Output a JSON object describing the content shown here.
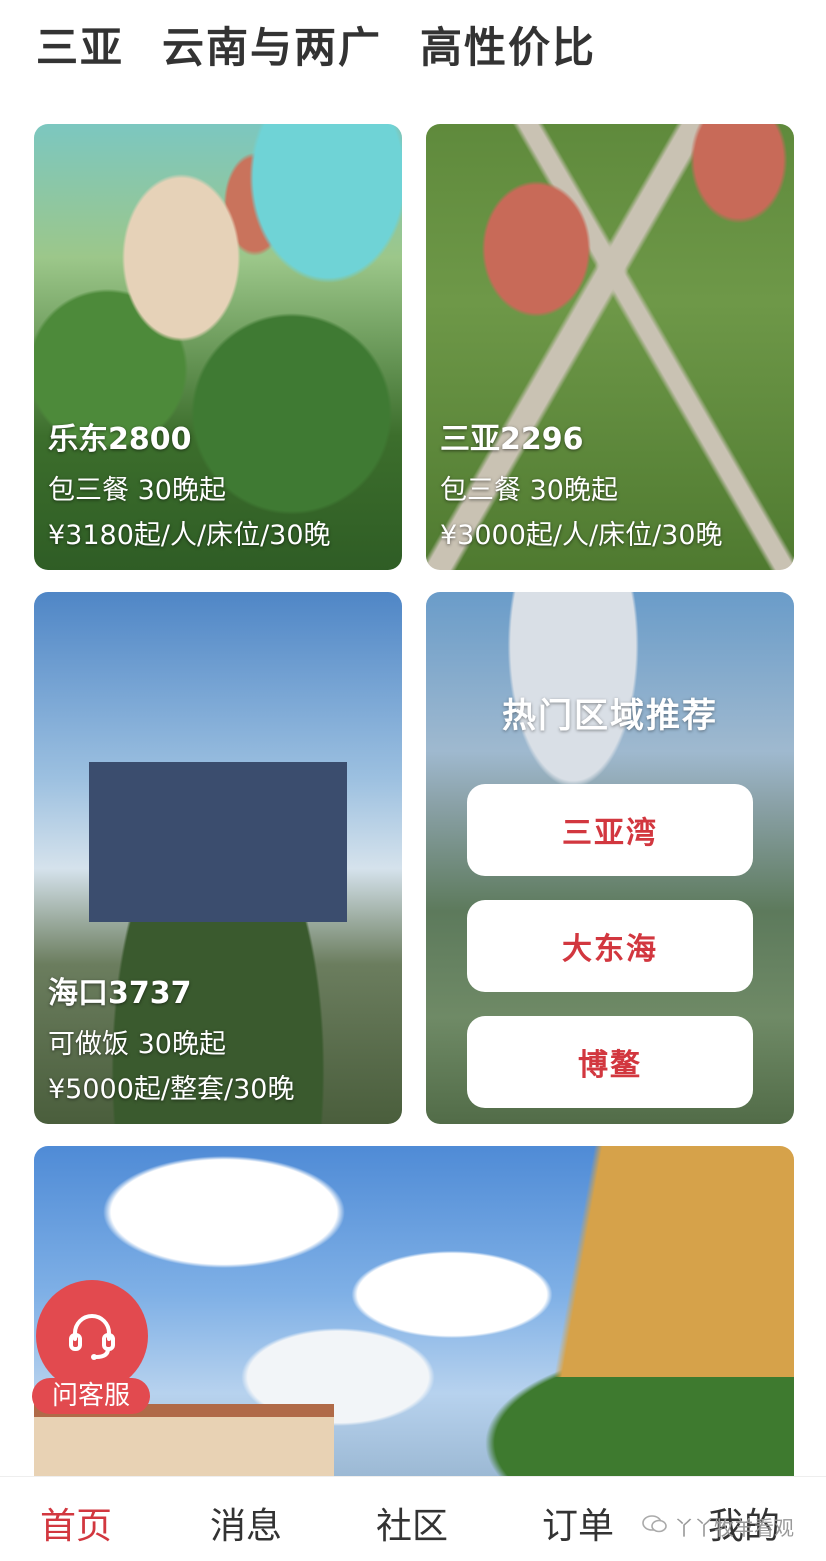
{
  "top_tabs": [
    "三亚",
    "云南与两广",
    "高性价比"
  ],
  "cards": {
    "ledong": {
      "title": "乐东2800",
      "line1": "包三餐  30晚起",
      "line2": "¥3180起/人/床位/30晚"
    },
    "sanya": {
      "title": "三亚2296",
      "line1": "包三餐  30晚起",
      "line2": "¥3000起/人/床位/30晚"
    },
    "haikou": {
      "title": "海口3737",
      "line1": "可做饭  30晚起",
      "line2": "¥5000起/整套/30晚"
    }
  },
  "hot_regions": {
    "title": "热门区域推荐",
    "items": [
      "三亚湾",
      "大东海",
      "博鳌"
    ]
  },
  "customer_service": {
    "label": "问客服",
    "icon": "headset-icon"
  },
  "bottom_nav": [
    "首页",
    "消息",
    "社区",
    "订单",
    "我的"
  ],
  "watermark": "丫丫牧羊看观",
  "colors": {
    "accent": "#d2373f",
    "cs_bg": "#e24a4f"
  }
}
